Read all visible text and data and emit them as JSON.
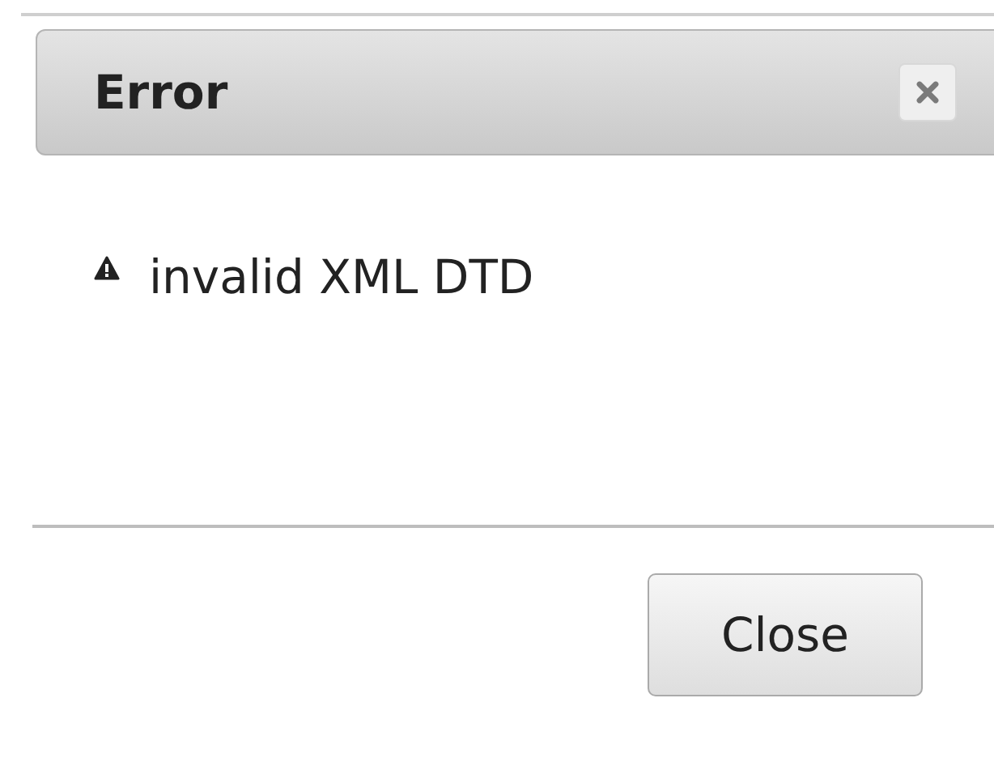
{
  "dialog": {
    "title": "Error",
    "message": "invalid XML DTD",
    "buttons": [
      "Close"
    ]
  }
}
